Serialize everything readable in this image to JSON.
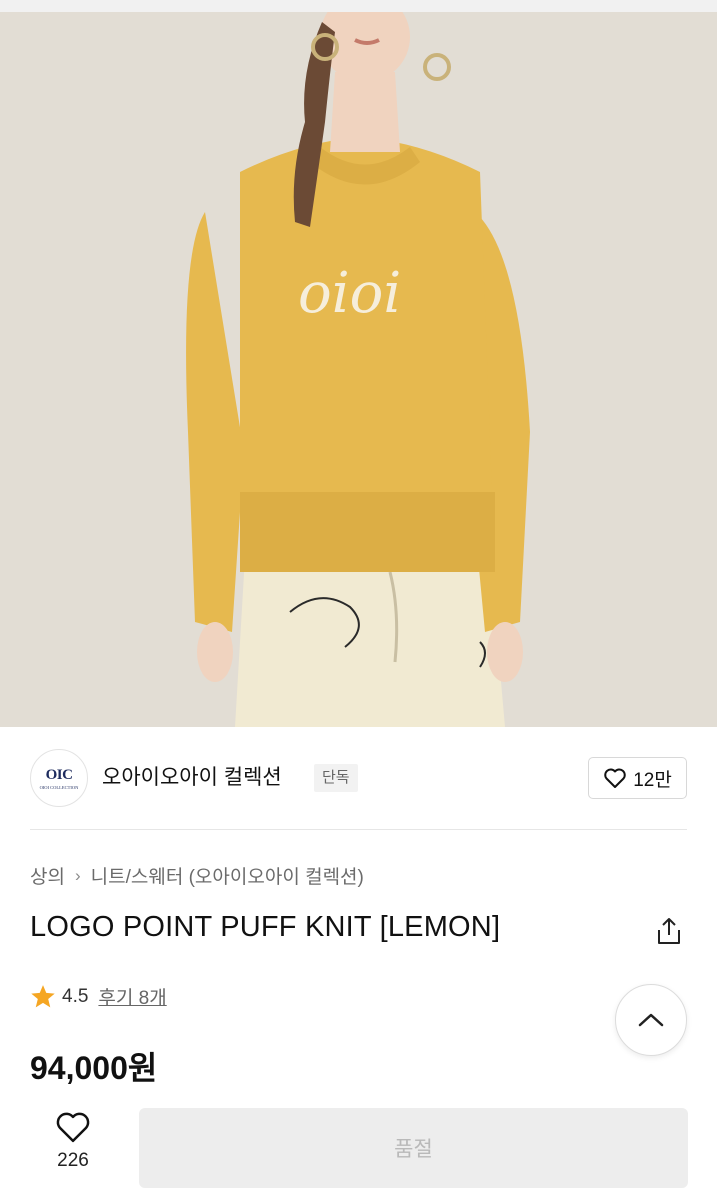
{
  "product_image": {
    "alt": "oioi",
    "colors": {
      "wall": "#e2ddd4",
      "sweater": "#e6b94f",
      "skirt": "#f1ead2",
      "skin": "#f0d3bf",
      "hair": "#6b4a35"
    }
  },
  "brand": {
    "logo_mark": "OIC",
    "logo_sub": "OIOI COLLECTION",
    "name": "오아이오아이 컬렉션",
    "badge": "단독",
    "likes": "12만"
  },
  "breadcrumb": {
    "category": "상의",
    "subcategory": "니트/스웨터 (오아이오아이 컬렉션)"
  },
  "product": {
    "title": "LOGO POINT PUFF KNIT [LEMON]",
    "rating": "4.5",
    "reviews": "후기 8개",
    "price": "94,000원"
  },
  "bottom_bar": {
    "wish_count": "226",
    "buy_label": "품절"
  },
  "icons": {
    "heart": "heart-icon",
    "share": "share-icon",
    "star": "star-icon",
    "chevron_up": "chevron-up-icon",
    "chevron_right": "chevron-right-icon"
  },
  "colors": {
    "star": "#f5a623",
    "text_primary": "#111111",
    "text_secondary": "#6b6b6b",
    "disabled_button": "#ededed",
    "disabled_text": "#b9b9b9",
    "brand_navy": "#1d2b5e"
  }
}
